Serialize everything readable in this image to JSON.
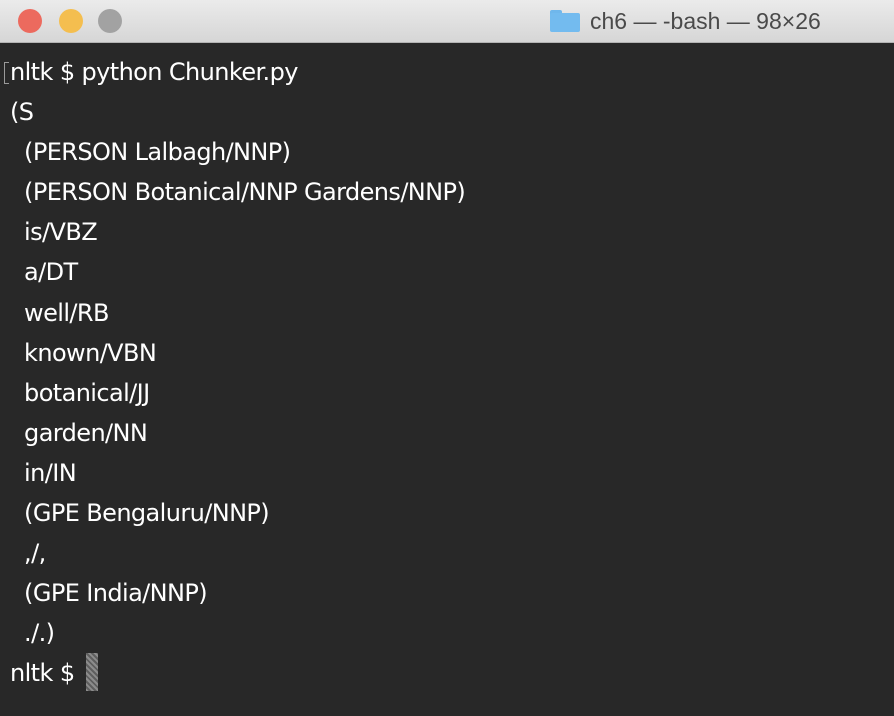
{
  "window": {
    "title": "ch6 — -bash — 98×26",
    "folder_icon": "folder-icon",
    "controls": [
      "close",
      "minimize",
      "zoom"
    ],
    "colors": {
      "close": "#ec6a5e",
      "minimize": "#f4be4f",
      "zoom": "#a2a2a2",
      "background": "#282828",
      "text": "#ffffff"
    }
  },
  "terminal": {
    "lines": [
      "nltk $ python Chunker.py",
      "(S",
      "  (PERSON Lalbagh/NNP)",
      "  (PERSON Botanical/NNP Gardens/NNP)",
      "  is/VBZ",
      "  a/DT",
      "  well/RB",
      "  known/VBN",
      "  botanical/JJ",
      "  garden/NN",
      "  in/IN",
      "  (GPE Bengaluru/NNP)",
      "  ,/,",
      "  (GPE India/NNP)",
      "  ./.)"
    ],
    "prompt": "nltk $ "
  }
}
